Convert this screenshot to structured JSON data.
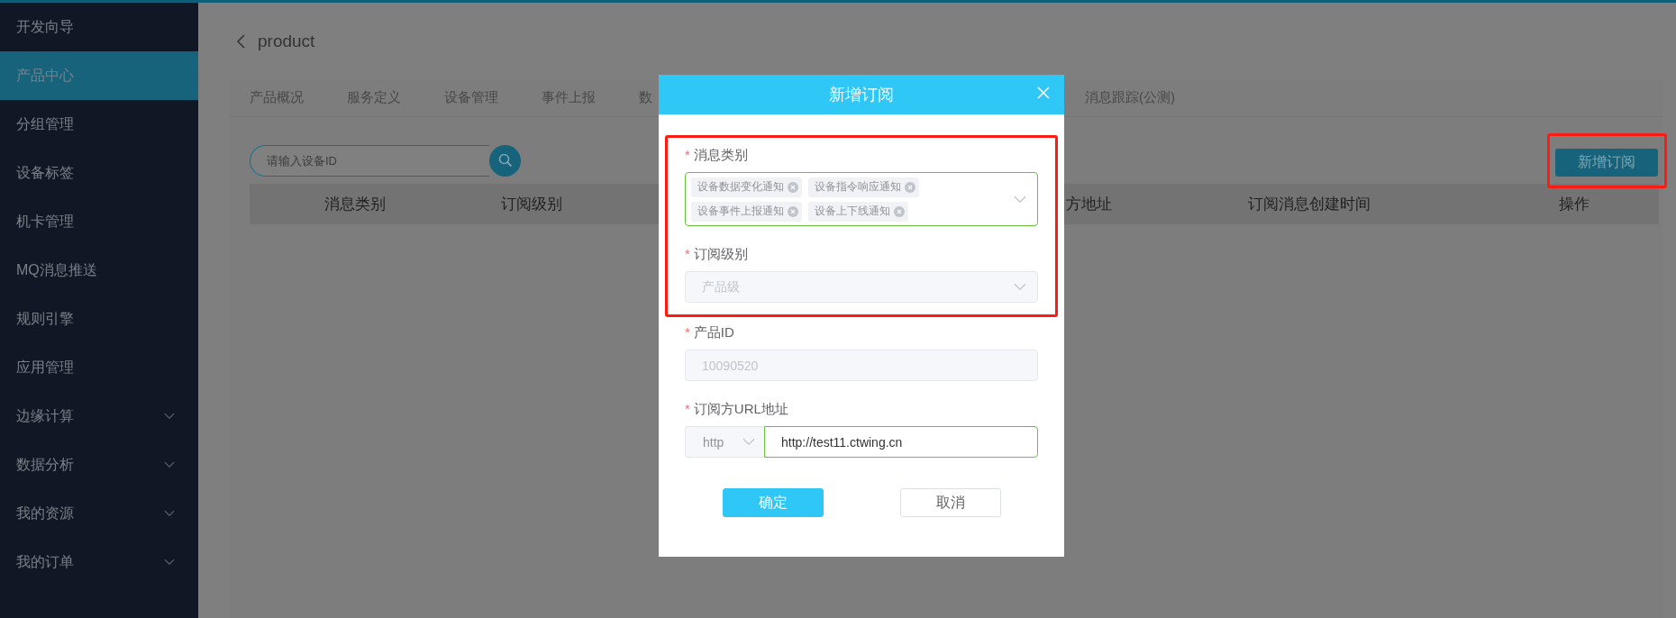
{
  "sidebar": {
    "items": [
      {
        "label": "开发向导",
        "selected": false,
        "has_submenu": false
      },
      {
        "label": "产品中心",
        "selected": true,
        "has_submenu": false
      },
      {
        "label": "分组管理",
        "selected": false,
        "has_submenu": false
      },
      {
        "label": "设备标签",
        "selected": false,
        "has_submenu": false
      },
      {
        "label": "机卡管理",
        "selected": false,
        "has_submenu": false
      },
      {
        "label": "MQ消息推送",
        "selected": false,
        "has_submenu": false
      },
      {
        "label": "规则引擎",
        "selected": false,
        "has_submenu": false
      },
      {
        "label": "应用管理",
        "selected": false,
        "has_submenu": false
      },
      {
        "label": "边缘计算",
        "selected": false,
        "has_submenu": true
      },
      {
        "label": "数据分析",
        "selected": false,
        "has_submenu": true
      },
      {
        "label": "我的资源",
        "selected": false,
        "has_submenu": true
      },
      {
        "label": "我的订单",
        "selected": false,
        "has_submenu": true
      }
    ]
  },
  "page": {
    "title": "product"
  },
  "tabs": [
    {
      "label": "产品概况",
      "selected": false
    },
    {
      "label": "服务定义",
      "selected": false
    },
    {
      "label": "设备管理",
      "selected": false
    },
    {
      "label": "事件上报",
      "selected": false
    },
    {
      "label": "数",
      "selected": false
    },
    {
      "label": "消息跟踪(公测)",
      "selected": false
    }
  ],
  "search": {
    "placeholder": "请输入设备ID"
  },
  "add_button": {
    "label": "新增订阅",
    "highlighted": true
  },
  "table": {
    "columns": [
      "消息类别",
      "订阅级别",
      "方地址",
      "订阅消息创建时间",
      "操作"
    ]
  },
  "dialog": {
    "title": "新增订阅",
    "highlighted_fields": [
      {
        "kind": "tags",
        "label": "消息类别",
        "required_mark": "*",
        "tags": [
          "设备数据变化通知",
          "设备指令响应通知",
          "设备事件上报通知",
          "设备上下线通知"
        ]
      },
      {
        "kind": "select",
        "label": "订阅级别",
        "required_mark": "*",
        "value": "产品级",
        "disabled": true
      }
    ],
    "fields": [
      {
        "kind": "input",
        "label": "产品ID",
        "required_mark": "*",
        "value": "10090520",
        "disabled": true
      },
      {
        "kind": "url",
        "label": "订阅方URL地址",
        "required_mark": "*",
        "protocol": "http",
        "value": "http://test11.ctwing.cn"
      }
    ],
    "buttons": [
      {
        "label": "确定",
        "primary": true
      },
      {
        "label": "取消",
        "primary": false
      }
    ]
  }
}
